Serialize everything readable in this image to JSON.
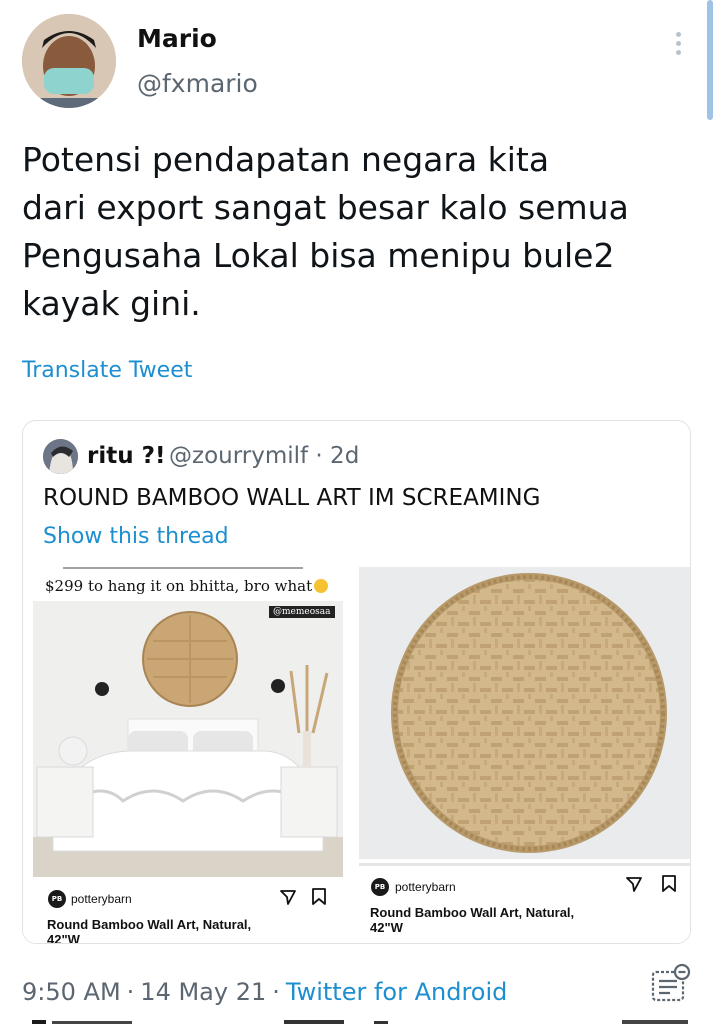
{
  "tweet": {
    "display_name": "Mario",
    "username": "@fxmario",
    "text": "Potensi pendapatan negara kita\ndari export sangat besar kalo semua\nPengusaha Lokal bisa menipu bule2\nkayak gini.",
    "translate_label": "Translate Tweet",
    "time": "9:50 AM",
    "date": "14 May 21",
    "source": "Twitter for Android",
    "separator": "·"
  },
  "quoted": {
    "display_name": "ritu ?!",
    "handle_and_age": "@zourrymilf · 2d",
    "text": "ROUND BAMBOO WALL ART IM SCREAMING",
    "show_thread_label": "Show this thread",
    "meme_caption": "$299 to hang it on bhitta, bro what",
    "watermark": "@memeosaa",
    "left_post": {
      "account": "potterybarn",
      "title_line1": "Round Bamboo Wall Art, Natural,",
      "title_line2": "42\"W"
    },
    "right_post": {
      "account": "potterybarn",
      "title_line1": "Round Bamboo Wall Art, Natural,",
      "title_line2": "42\"W"
    }
  },
  "icons": [
    "more-vertical-icon",
    "share-icon",
    "bookmark-icon",
    "analytics-icon"
  ],
  "colors": {
    "link": "#1d8fd1",
    "secondary_text": "#5b6670",
    "primary_text": "#0f1419",
    "card_border": "#dfe3e6"
  }
}
